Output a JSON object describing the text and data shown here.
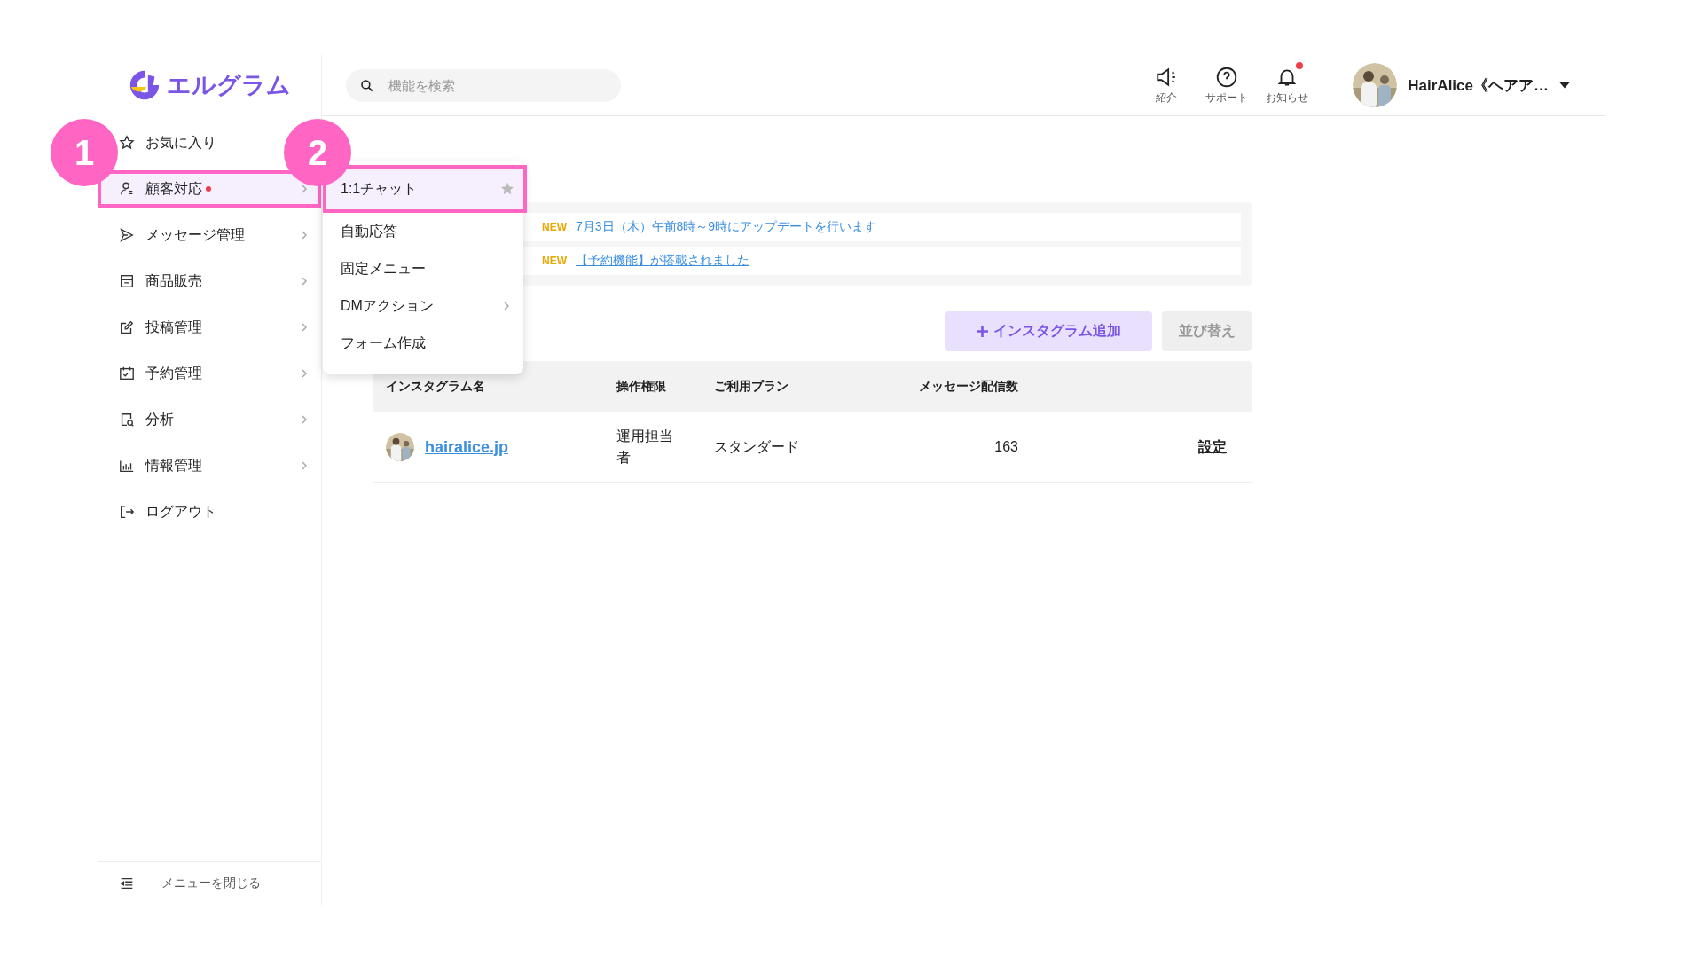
{
  "logo": {
    "text": "エルグラム"
  },
  "search": {
    "placeholder": "機能を検索"
  },
  "header_icons": [
    {
      "label": "紹介",
      "badge": false
    },
    {
      "label": "サポート",
      "badge": false
    },
    {
      "label": "お知らせ",
      "badge": true
    }
  ],
  "user": {
    "name": "HairAlice《ヘアア…"
  },
  "sidebar": {
    "items": [
      {
        "label": "お気に入り",
        "selected": false,
        "has_submenu": false,
        "badge": false
      },
      {
        "label": "顧客対応",
        "selected": true,
        "has_submenu": true,
        "badge": true
      },
      {
        "label": "メッセージ管理",
        "selected": false,
        "has_submenu": true,
        "badge": false
      },
      {
        "label": "商品販売",
        "selected": false,
        "has_submenu": true,
        "badge": false
      },
      {
        "label": "投稿管理",
        "selected": false,
        "has_submenu": true,
        "badge": false
      },
      {
        "label": "予約管理",
        "selected": false,
        "has_submenu": true,
        "badge": false
      },
      {
        "label": "分析",
        "selected": false,
        "has_submenu": true,
        "badge": false
      },
      {
        "label": "情報管理",
        "selected": false,
        "has_submenu": true,
        "badge": false
      },
      {
        "label": "ログアウト",
        "selected": false,
        "has_submenu": false,
        "badge": false
      }
    ],
    "close_menu": "メニューを閉じる"
  },
  "submenu": {
    "items": [
      {
        "label": "1:1チャット",
        "selected": true,
        "has_submenu": false,
        "star": true
      },
      {
        "label": "自動応答",
        "selected": false,
        "has_submenu": false,
        "star": false
      },
      {
        "label": "固定メニュー",
        "selected": false,
        "has_submenu": false,
        "star": false
      },
      {
        "label": "DMアクション",
        "selected": false,
        "has_submenu": true,
        "star": false
      },
      {
        "label": "フォーム作成",
        "selected": false,
        "has_submenu": false,
        "star": false
      }
    ]
  },
  "annotations": [
    {
      "number": "1"
    },
    {
      "number": "2"
    }
  ],
  "notices": [
    {
      "badge": "NEW",
      "text": "7月3日（木）午前8時～9時にアップデートを行います"
    },
    {
      "badge": "NEW",
      "text": "【予約機能】が搭載されました"
    }
  ],
  "buttons": {
    "add": "インスタグラム追加",
    "sort": "並び替え"
  },
  "table": {
    "columns": [
      "インスタグラム名",
      "操作権限",
      "ご利用プラン",
      "メッセージ配信数"
    ],
    "rows": [
      {
        "name": "hairalice.jp",
        "role": "運用担当者",
        "plan": "スタンダード",
        "count": "163",
        "action": "設定"
      }
    ]
  }
}
